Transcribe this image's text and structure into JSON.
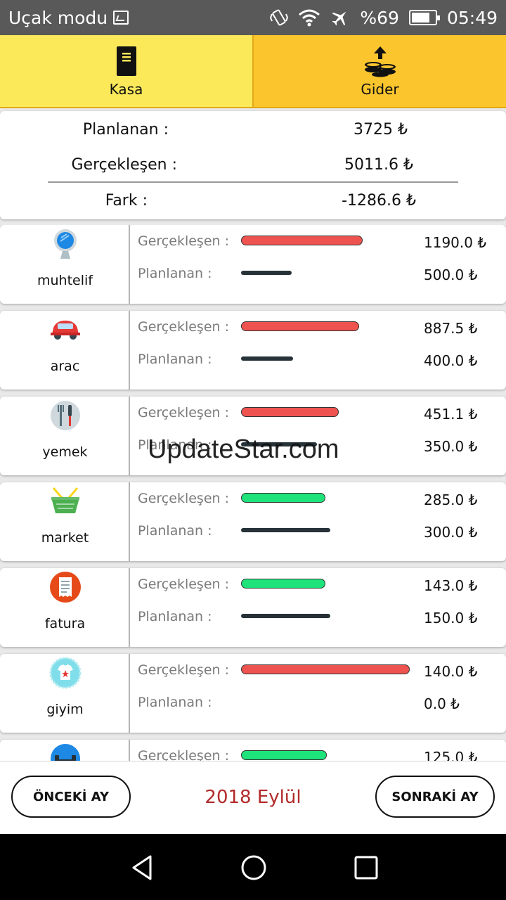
{
  "status_bar": {
    "left_text": "Uçak modu",
    "battery": "%69",
    "time": "05:49",
    "icons": [
      "image-icon",
      "vibrate-icon",
      "wifi-icon",
      "airplane-icon",
      "battery-icon"
    ]
  },
  "tabs": [
    {
      "label": "Kasa",
      "icon": "notebook-icon",
      "color": "#fbe95a"
    },
    {
      "label": "Gider",
      "icon": "coins-upload-icon",
      "color": "#fbc52e"
    }
  ],
  "summary": {
    "planned_label": "Planlanan :",
    "planned_value": "3725 ₺",
    "actual_label": "Gerçekleşen :",
    "actual_value": "5011.6 ₺",
    "diff_label": "Fark :",
    "diff_value": "-1286.6 ₺"
  },
  "row_labels": {
    "actual": "Gerçekleşen :",
    "planned": "Planlanan :"
  },
  "categories": [
    {
      "name": "muhtelif",
      "icon": "mirror-icon",
      "actual": "1190.0 ₺",
      "planned": "500.0 ₺",
      "actual_fill": 0.72,
      "planned_fill": 0.3,
      "over_budget": true
    },
    {
      "name": "arac",
      "icon": "car-icon",
      "actual": "887.5 ₺",
      "planned": "400.0 ₺",
      "actual_fill": 0.7,
      "planned_fill": 0.31,
      "over_budget": true
    },
    {
      "name": "yemek",
      "icon": "fork-knife-icon",
      "actual": "451.1 ₺",
      "planned": "350.0 ₺",
      "actual_fill": 0.58,
      "planned_fill": 0.45,
      "over_budget": true
    },
    {
      "name": "market",
      "icon": "basket-icon",
      "actual": "285.0 ₺",
      "planned": "300.0 ₺",
      "actual_fill": 0.5,
      "planned_fill": 0.53,
      "over_budget": false
    },
    {
      "name": "fatura",
      "icon": "receipt-icon",
      "actual": "143.0 ₺",
      "planned": "150.0 ₺",
      "actual_fill": 0.5,
      "planned_fill": 0.53,
      "over_budget": false
    },
    {
      "name": "giyim",
      "icon": "shirt-icon",
      "actual": "140.0 ₺",
      "planned": "0.0 ₺",
      "actual_fill": 1.0,
      "planned_fill": 0.0,
      "over_budget": true
    },
    {
      "name": "",
      "icon": "dumbbell-icon",
      "actual": "125.0 ₺",
      "planned": "",
      "actual_fill": 0.51,
      "planned_fill": 0.0,
      "over_budget": false
    }
  ],
  "watermark": "UpdateStar.com",
  "footer": {
    "prev_label": "ÖNCEKİ AY",
    "month": "2018 Eylül",
    "next_label": "SONRAKİ AY"
  },
  "colors": {
    "over_budget": "#ef5350",
    "under_budget": "#1ee27a",
    "planned_bar": "#263238",
    "month_text": "#b22b2b"
  }
}
